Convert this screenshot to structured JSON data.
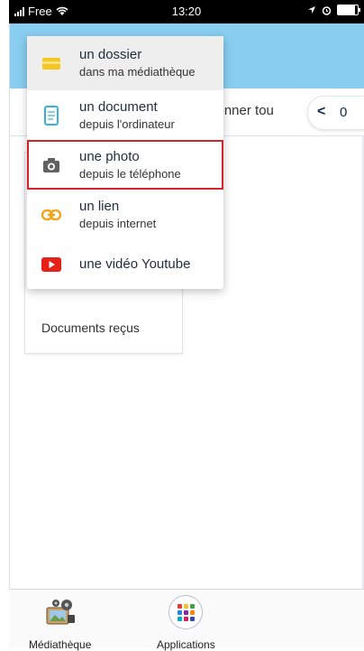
{
  "status_bar": {
    "carrier": "Free",
    "time": "13:20"
  },
  "header": {
    "selection_text": "tionner tou",
    "pager_prev": "<",
    "pager_count": "0"
  },
  "folder_card": {
    "label": "Documents reçus"
  },
  "menu": {
    "items": [
      {
        "title": "un dossier",
        "subtitle": "dans ma médiathèque",
        "icon": "folder-icon",
        "color": "#f4c623"
      },
      {
        "title": "un document",
        "subtitle": "depuis l'ordinateur",
        "icon": "document-icon",
        "color": "#3bb0e0"
      },
      {
        "title": "une photo",
        "subtitle": "depuis le téléphone",
        "icon": "camera-icon",
        "color": "#616161"
      },
      {
        "title": "un lien",
        "subtitle": "depuis internet",
        "icon": "link-icon",
        "color": "#f2a51a"
      },
      {
        "title": "une vidéo Youtube",
        "subtitle": "",
        "icon": "youtube-icon",
        "color": "#e62117"
      }
    ],
    "highlight_color": "#d4242b"
  },
  "bottom_nav": [
    {
      "label": "Médiathèque",
      "icon": "media-library-icon"
    },
    {
      "label": "Applications",
      "icon": "apps-grid-icon"
    }
  ],
  "colors": {
    "accent_band": "#89cdf0",
    "nav_text": "#0c2a4a"
  }
}
